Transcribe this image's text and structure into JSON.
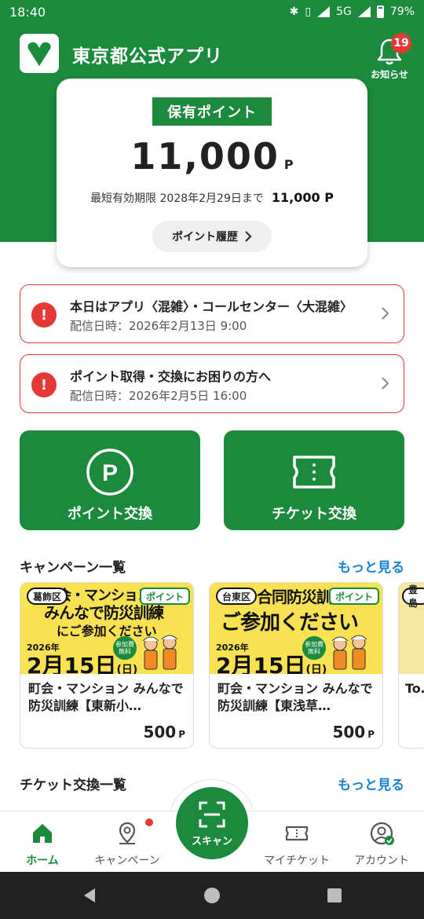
{
  "status_bar": {
    "time": "18:40",
    "network": "5G",
    "battery": "79%"
  },
  "header": {
    "app_title": "東京都公式アプリ",
    "notifications": {
      "count": "19",
      "label": "お知らせ"
    }
  },
  "points": {
    "title": "保有ポイント",
    "value": "11,000",
    "unit": "P",
    "expiry_label": "最短有効期限 2028年2月29日まで",
    "expiry_value": "11,000 P",
    "history_button": "ポイント履歴"
  },
  "notices": [
    {
      "title": "本日はアプリ〈混雑〉・コールセンター〈大混雑〉",
      "date": "配信日時：2026年2月13日 9:00"
    },
    {
      "title": "ポイント取得・交換にお困りの方へ",
      "date": "配信日時：2026年2月5日 16:00"
    }
  ],
  "actions": {
    "point_exchange": "ポイント交換",
    "ticket_exchange": "チケット交換"
  },
  "campaigns": {
    "title": "キャンペーン一覧",
    "more": "もっと見る",
    "items": [
      {
        "ward": "葛飾区",
        "tag": "ポイント",
        "headline": "町会・マンション",
        "headline2": "みんなで防災訓練",
        "sub": "にご参加ください",
        "year": "2026年",
        "date": "2月15日",
        "dow": "(日)",
        "free": "参加費無料",
        "name": "町会・マンション みんなで防災訓練【東新小…",
        "points": "500",
        "unit": "P"
      },
      {
        "ward": "台東区",
        "tag": "ポイント",
        "headline": "合同防災訓練",
        "headline2": "ご参加ください",
        "sub": "",
        "year": "2026年",
        "date": "2月15日",
        "dow": "(日)",
        "free": "参加費無料",
        "name": "町会・マンション みんなで防災訓練【東浅草…",
        "points": "500",
        "unit": "P"
      },
      {
        "ward": "豊島",
        "name": "To… タ…"
      }
    ]
  },
  "tickets": {
    "title": "チケット交換一覧",
    "more": "もっと見る"
  },
  "bottom_nav": {
    "home": "ホーム",
    "campaign": "キャンペーン",
    "scan": "スキャン",
    "my_ticket": "マイチケット",
    "account": "アカウント"
  },
  "colors": {
    "brand": "#1b8a3c",
    "alert": "#e53935",
    "link": "#1a82d6"
  }
}
